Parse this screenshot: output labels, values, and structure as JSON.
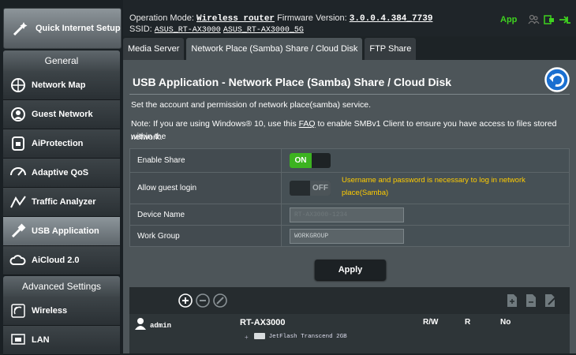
{
  "sidebar": {
    "quick_setup": "Quick Internet Setup",
    "general_header": "General",
    "general_items": [
      {
        "label": "Network Map",
        "icon": "network-map-icon"
      },
      {
        "label": "Guest Network",
        "icon": "guest-network-icon"
      },
      {
        "label": "AiProtection",
        "icon": "aiprotection-icon"
      },
      {
        "label": "Adaptive QoS",
        "icon": "adaptive-qos-icon"
      },
      {
        "label": "Traffic Analyzer",
        "icon": "traffic-analyzer-icon"
      },
      {
        "label": "USB Application",
        "icon": "usb-application-icon",
        "active": true
      },
      {
        "label": "AiCloud 2.0",
        "icon": "aicloud-icon"
      }
    ],
    "advanced_header": "Advanced Settings",
    "advanced_items": [
      {
        "label": "Wireless",
        "icon": "wireless-icon"
      },
      {
        "label": "LAN",
        "icon": "lan-icon"
      }
    ]
  },
  "topbar": {
    "mode_label": "Operation Mode:",
    "mode_value": "Wireless router",
    "fw_label": "Firmware Version:",
    "fw_value": "3.0.0.4.384_7739",
    "ssid_label": "SSID:",
    "ssid_1": "ASUS_RT-AX3000",
    "ssid_2": "ASUS_RT-AX3000_5G",
    "app_label": "App"
  },
  "tabs": [
    {
      "label": "Media Server"
    },
    {
      "label": "Network Place (Samba) Share / Cloud Disk",
      "active": true
    },
    {
      "label": "FTP Share"
    }
  ],
  "page": {
    "title": "USB Application - Network Place (Samba) Share / Cloud Disk",
    "desc1": "Set the account and permission of network place(samba) service.",
    "note_pre": "Note: If you are using Windows® 10, use this ",
    "note_link": "FAQ",
    "note_post": " to enable SMBv1 Client to ensure you have access to files stored within the",
    "note_line2": "network."
  },
  "form": {
    "enable_share_label": "Enable Share",
    "enable_share_state": "ON",
    "guest_login_label": "Allow guest login",
    "guest_login_state": "OFF",
    "guest_warning_1": "Username and password is necessary to log in network",
    "guest_warning_2": "place(Samba)",
    "device_name_label": "Device Name",
    "device_name_value": "RT-AX3000-1234",
    "workgroup_label": "Work Group",
    "workgroup_value": "WORKGROUP",
    "apply_label": "Apply"
  },
  "accounts": {
    "user": "admin",
    "device": "RT-AX3000",
    "col_rw": "R/W",
    "col_r": "R",
    "col_no": "No",
    "disk": "JetFlash Transcend 2GB"
  },
  "colors": {
    "accent_green": "#3cb320",
    "warning": "#ffcc00",
    "app_green": "#3fd21f",
    "back_button": "#1a6fd0"
  }
}
